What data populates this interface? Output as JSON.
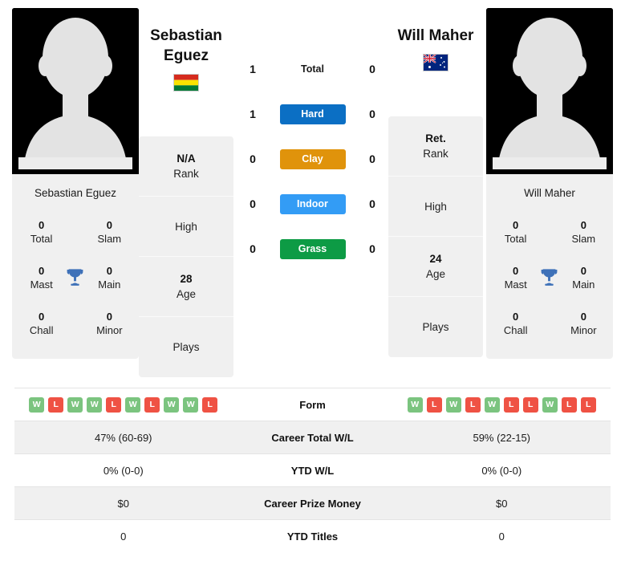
{
  "players": {
    "left": {
      "name": "Sebastian Eguez",
      "first_name": "Sebastian",
      "last_name": "Eguez",
      "country": "Bolivia",
      "flag": "bolivia-flag",
      "avatar": "player-photo-placeholder",
      "titles": {
        "total": "0",
        "total_label": "Total",
        "slam": "0",
        "slam_label": "Slam",
        "mast": "0",
        "mast_label": "Mast",
        "main": "0",
        "main_label": "Main",
        "chall": "0",
        "chall_label": "Chall",
        "minor": "0",
        "minor_label": "Minor",
        "icon": "trophy-icon"
      },
      "info": [
        {
          "value": "N/A",
          "label": "Rank"
        },
        {
          "value": "",
          "label": "High"
        },
        {
          "value": "28",
          "label": "Age"
        },
        {
          "value": "",
          "label": "Plays"
        }
      ]
    },
    "right": {
      "name": "Will Maher",
      "first_name": "Will",
      "last_name": "Maher",
      "country": "Australia",
      "flag": "australia-flag",
      "avatar": "player-photo-placeholder",
      "titles": {
        "total": "0",
        "total_label": "Total",
        "slam": "0",
        "slam_label": "Slam",
        "mast": "0",
        "mast_label": "Mast",
        "main": "0",
        "main_label": "Main",
        "chall": "0",
        "chall_label": "Chall",
        "minor": "0",
        "minor_label": "Minor",
        "icon": "trophy-icon"
      },
      "info": [
        {
          "value": "Ret.",
          "label": "Rank"
        },
        {
          "value": "",
          "label": "High"
        },
        {
          "value": "24",
          "label": "Age"
        },
        {
          "value": "",
          "label": "Plays"
        }
      ]
    }
  },
  "head_to_head": [
    {
      "label": "Total",
      "left": "1",
      "right": "0",
      "color": "none",
      "style": "plain"
    },
    {
      "label": "Hard",
      "left": "1",
      "right": "0",
      "color": "#0b6fc4",
      "style": "badge"
    },
    {
      "label": "Clay",
      "left": "0",
      "right": "0",
      "color": "#e0930b",
      "style": "badge"
    },
    {
      "label": "Indoor",
      "left": "0",
      "right": "0",
      "color": "#339cf5",
      "style": "badge"
    },
    {
      "label": "Grass",
      "left": "0",
      "right": "0",
      "color": "#0d9b45",
      "style": "badge"
    }
  ],
  "form_row": {
    "label": "Form",
    "left": [
      "W",
      "L",
      "W",
      "W",
      "L",
      "W",
      "L",
      "W",
      "W",
      "L"
    ],
    "right": [
      "W",
      "L",
      "W",
      "L",
      "W",
      "L",
      "L",
      "W",
      "L",
      "L"
    ],
    "win_color": "#7bc47f",
    "loss_color": "#ef5244"
  },
  "stats_rows": [
    {
      "label": "Career Total W/L",
      "left": "47% (60-69)",
      "right": "59% (22-15)"
    },
    {
      "label": "YTD W/L",
      "left": "0% (0-0)",
      "right": "0% (0-0)"
    },
    {
      "label": "Career Prize Money",
      "left": "$0",
      "right": "$0"
    },
    {
      "label": "YTD Titles",
      "left": "0",
      "right": "0"
    }
  ]
}
